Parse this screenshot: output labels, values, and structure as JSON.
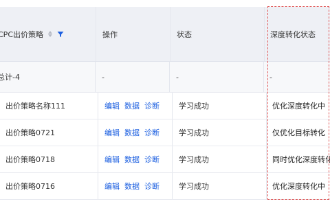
{
  "columns": {
    "strategy": "CPC出价策略",
    "actions": "操作",
    "status": "状态",
    "deep_status": "深度转化状态"
  },
  "total": {
    "label": "总计-4",
    "actions": "-",
    "status": "-",
    "deep_status": "-"
  },
  "rows": [
    {
      "name": "出价策略名称111",
      "edit": "编辑",
      "data": "数据",
      "diagnose": "诊断",
      "status": "学习成功",
      "deep_status": "优化深度转化中"
    },
    {
      "name": "出价策略0721",
      "edit": "编辑",
      "data": "数据",
      "diagnose": "诊断",
      "status": "学习成功",
      "deep_status": "仅优化目标转化"
    },
    {
      "name": "出价策略0718",
      "edit": "编辑",
      "data": "数据",
      "diagnose": "诊断",
      "status": "学习成功",
      "deep_status": "同时优化深度转化"
    },
    {
      "name": "出价策略0716",
      "edit": "编辑",
      "data": "数据",
      "diagnose": "诊断",
      "status": "学习成功",
      "deep_status": "优化深度转化中"
    }
  ],
  "colors": {
    "link": "#1c5fe0",
    "filter_active": "#1c5fe0",
    "highlight_border": "#e05b5b",
    "header_bg": "#eef0f5"
  },
  "icons": {
    "sort": "sort-icon",
    "filter": "filter-icon"
  }
}
